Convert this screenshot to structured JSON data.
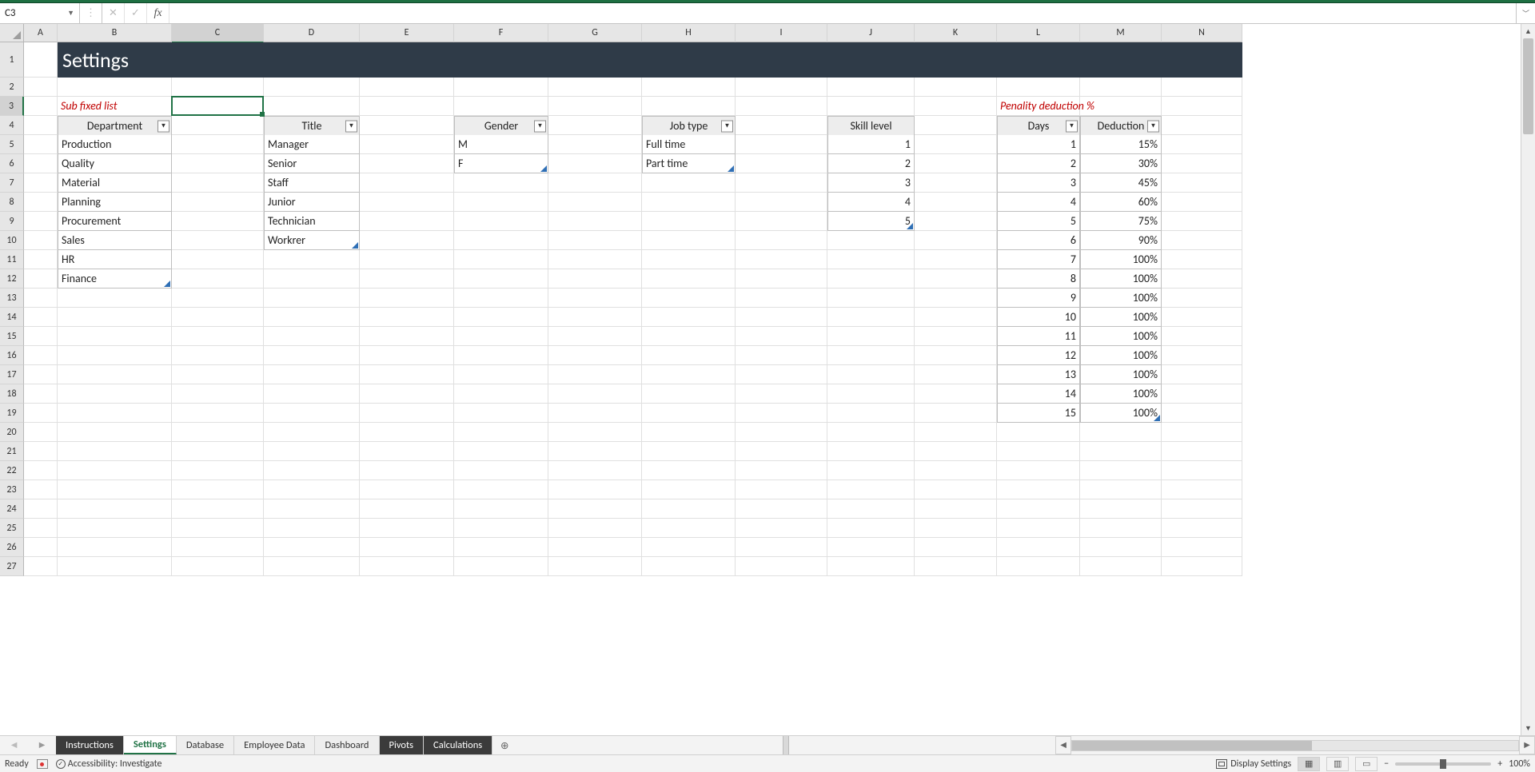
{
  "name_box": "C3",
  "formula_bar": {
    "fx": "fx",
    "value": ""
  },
  "columns": [
    "A",
    "B",
    "C",
    "D",
    "E",
    "F",
    "G",
    "H",
    "I",
    "J",
    "K",
    "L",
    "M",
    "N"
  ],
  "selected_column": "C",
  "selected_row": 3,
  "row_headers": [
    1,
    2,
    3,
    4,
    5,
    6,
    7,
    8,
    9,
    10,
    11,
    12,
    13,
    14,
    15,
    16,
    17,
    18,
    19,
    20,
    21,
    22,
    23,
    24,
    25,
    26,
    27
  ],
  "title": "Settings",
  "sub_fixed_label": "Sub fixed list",
  "penality_label": "Penality deduction %",
  "tables": {
    "department": {
      "header": "Department",
      "items": [
        "Production",
        "Quality",
        "Material",
        "Planning",
        "Procurement",
        "Sales",
        "HR",
        "Finance"
      ]
    },
    "title_tbl": {
      "header": "Title",
      "items": [
        "Manager",
        "Senior",
        "Staff",
        "Junior",
        "Technician",
        "Workrer"
      ]
    },
    "gender": {
      "header": "Gender",
      "items": [
        "M",
        "F"
      ]
    },
    "jobtype": {
      "header": "Job type",
      "items": [
        "Full time",
        "Part time"
      ]
    },
    "skill": {
      "header": "Skill level",
      "items": [
        "1",
        "2",
        "3",
        "4",
        "5"
      ]
    },
    "penality": {
      "headers": [
        "Days",
        "Deduction"
      ],
      "rows": [
        [
          "1",
          "15%"
        ],
        [
          "2",
          "30%"
        ],
        [
          "3",
          "45%"
        ],
        [
          "4",
          "60%"
        ],
        [
          "5",
          "75%"
        ],
        [
          "6",
          "90%"
        ],
        [
          "7",
          "100%"
        ],
        [
          "8",
          "100%"
        ],
        [
          "9",
          "100%"
        ],
        [
          "10",
          "100%"
        ],
        [
          "11",
          "100%"
        ],
        [
          "12",
          "100%"
        ],
        [
          "13",
          "100%"
        ],
        [
          "14",
          "100%"
        ],
        [
          "15",
          "100%"
        ]
      ]
    }
  },
  "tabs": [
    "Instructions",
    "Settings",
    "Database",
    "Employee Data",
    "Dashboard",
    "Pivots",
    "Calculations"
  ],
  "dark_tabs": [
    "Instructions",
    "Pivots",
    "Calculations"
  ],
  "active_tab": "Settings",
  "status": {
    "ready": "Ready",
    "accessibility": "Accessibility: Investigate",
    "display": "Display Settings",
    "zoom": "100%"
  }
}
